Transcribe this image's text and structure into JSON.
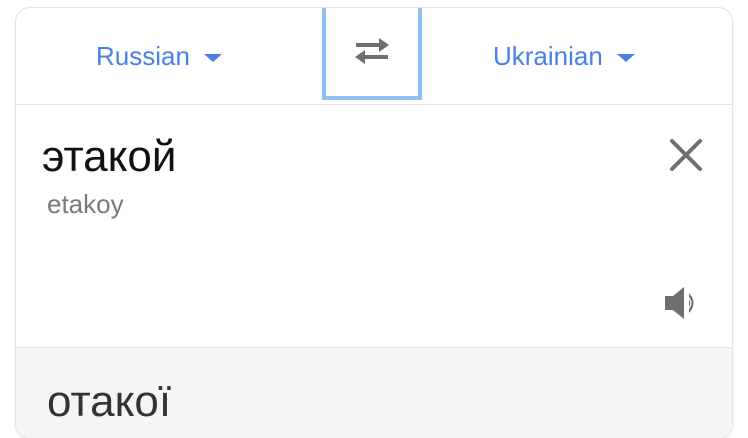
{
  "languages": {
    "source_label": "Russian",
    "target_label": "Ukrainian"
  },
  "source": {
    "text": "этакой",
    "transliteration": "etakoy"
  },
  "result": {
    "text": "отакої"
  },
  "icons": {
    "swap": "swap-arrows-icon",
    "source_caret": "caret-down-icon",
    "target_caret": "caret-down-icon",
    "clear": "close-icon",
    "speaker": "speaker-icon"
  },
  "colors": {
    "accent": "#4a7ee8",
    "swap_focus_border": "#8ec0f4",
    "icon_gray": "#6f6f6f",
    "result_background": "#f5f5f5"
  }
}
